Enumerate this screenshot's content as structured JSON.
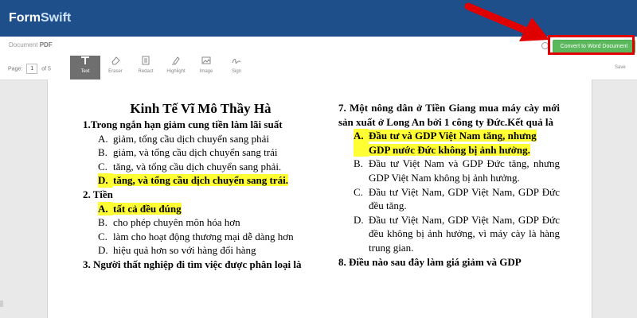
{
  "app": {
    "logo_part1": "Form",
    "logo_part2": "Swift"
  },
  "docbar": {
    "document_label": "Document",
    "document_type": "PDF",
    "convert_button": "Convert to Word Document"
  },
  "toolbar": {
    "page_label": "Page:",
    "page_value": "1",
    "page_total": "of 5",
    "tools": [
      {
        "label": "Text",
        "icon": "text-tool-icon",
        "active": true
      },
      {
        "label": "Eraser",
        "icon": "eraser-icon",
        "active": false
      },
      {
        "label": "Redact",
        "icon": "redact-icon",
        "active": false
      },
      {
        "label": "Highlight",
        "icon": "highlight-pen-icon",
        "active": false
      },
      {
        "label": "Image",
        "icon": "image-icon",
        "active": false
      },
      {
        "label": "Sign",
        "icon": "signature-icon",
        "active": false
      }
    ],
    "save_label": "Save"
  },
  "document": {
    "title": "Kinh Tế Vĩ Mô Thầy Hà",
    "left": {
      "q1": "1.Trong ngắn hạn giảm cung tiền làm lãi suất",
      "q1_options": [
        {
          "letter": "A.",
          "text": "giảm, tổng cầu dịch chuyển sang phải"
        },
        {
          "letter": "B.",
          "text": "giảm, và tổng cầu dịch chuyển sang trái"
        },
        {
          "letter": "C.",
          "text": "tăng, và tổng cầu dịch chuyển sang phải."
        },
        {
          "letter": "D.",
          "text": "tăng, và tổng cầu dịch chuyển sang trái."
        }
      ],
      "q2": "2. Tiền",
      "q2_options": [
        {
          "letter": "A.",
          "text": "tất cả đều đúng"
        },
        {
          "letter": "B.",
          "text": "cho phép chuyên môn hóa hơn"
        },
        {
          "letter": "C.",
          "text": "làm cho hoạt động thương mại dễ dàng hơn"
        },
        {
          "letter": "D.",
          "text": "hiệu quả hơn so với hàng đổi hàng"
        }
      ],
      "q3": "3. Người thất nghiệp đi tìm việc được phân loại là"
    },
    "right": {
      "q7": "7. Một nông dân ở Tiền Giang mua máy cày mới sản xuất ở Long An bởi 1 công ty Đức.Kết quả là",
      "q7_options": [
        {
          "letter": "A.",
          "text": "Đầu tư và GDP Việt Nam tăng, nhưng GDP nước Đức không bị ảnh hưởng."
        },
        {
          "letter": "B.",
          "text": "Đầu tư Việt Nam và GDP Đức tăng, nhưng GDP Việt Nam không bị ảnh hưởng."
        },
        {
          "letter": "C.",
          "text": "Đầu tư Việt Nam, GDP Việt Nam, GDP Đức đều tăng."
        },
        {
          "letter": "D.",
          "text": "Đầu tư Việt Nam, GDP Việt Nam, GDP Đức đều không bị ảnh hưởng, vì máy cày là hàng trung gian."
        }
      ],
      "q8": "8. Điều nào sau đây làm giá giảm và GDP"
    }
  },
  "colors": {
    "topbar": "#1f4f8a",
    "convert_button": "#5cb85c",
    "annotation_red": "#e00000",
    "answer_highlight": "#ffff33"
  }
}
